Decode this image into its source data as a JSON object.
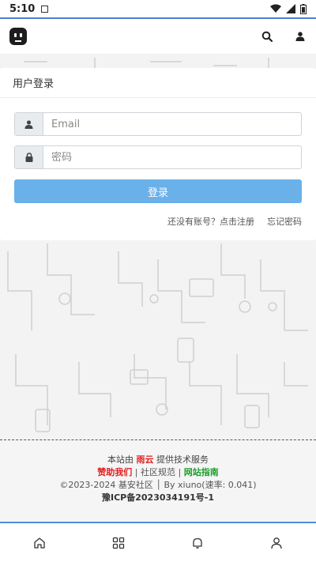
{
  "status_bar": {
    "time": "5:10"
  },
  "topnav": {
    "logo_icon": "robot-face-icon",
    "search_icon": "search-icon",
    "user_icon": "user-icon"
  },
  "login": {
    "title": "用户登录",
    "email_placeholder": "Email",
    "password_placeholder": "密码",
    "submit_label": "登录",
    "register_link": "还没有账号？点击注册",
    "forgot_link": "忘记密码"
  },
  "footer": {
    "line1_prefix": "本站由 ",
    "line1_brand": "雨云",
    "line1_suffix": " 提供技术服务",
    "sponsor": "赞助我们",
    "sep1": " | ",
    "rules": "社区规范",
    "sep2": " | ",
    "guide": "网站指南",
    "copyright": "©2023-2024 基安社区 │ By xiuno(速率: 0.041)",
    "icp": "豫ICP备2023034191号-1"
  },
  "colors": {
    "accent": "#4f7fd0",
    "button": "#6ab0e9",
    "red": "#e02020",
    "green": "#1b9e2a"
  },
  "tabs": [
    {
      "icon": "home-icon"
    },
    {
      "icon": "grid-icon"
    },
    {
      "icon": "bell-icon"
    },
    {
      "icon": "user-icon"
    }
  ]
}
